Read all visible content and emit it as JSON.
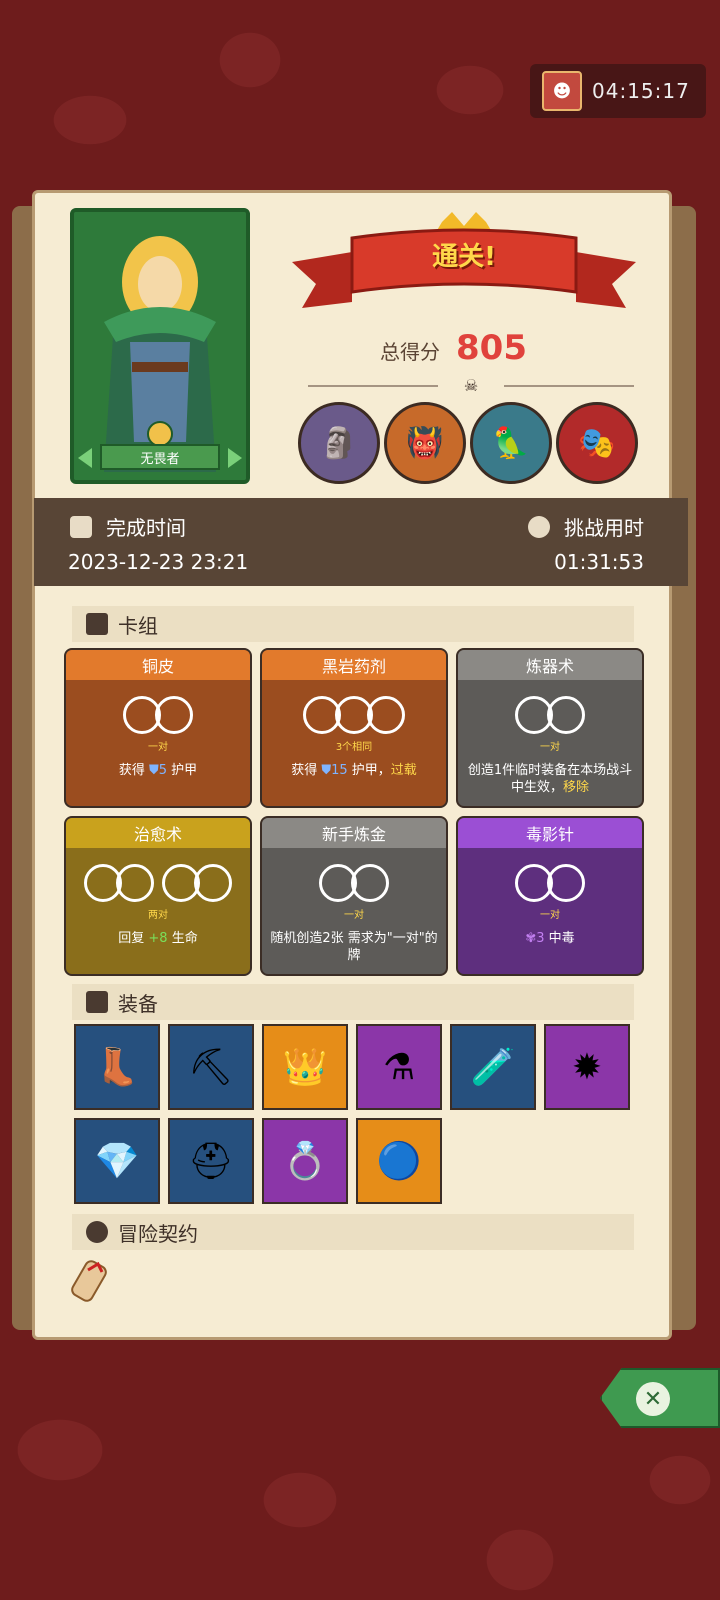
{
  "timer": {
    "time": "04:15:17",
    "avatar_icon": "boss-avatar-icon"
  },
  "hero": {
    "name": "无畏者"
  },
  "result": {
    "banner": "通关!",
    "score_label": "总得分",
    "score_value": "805"
  },
  "times": {
    "completion_label": "完成时间",
    "completion_value": "2023-12-23 23:21",
    "challenge_label": "挑战用时",
    "challenge_value": "01:31:53"
  },
  "deck": {
    "title": "卡组",
    "cards": [
      {
        "name": "铜皮",
        "count": "一对",
        "desc_pre": "获得 ",
        "desc_num": "5",
        "desc_post": " 护甲",
        "desc_hl": ""
      },
      {
        "name": "黑岩药剂",
        "count": "3个相同",
        "desc_pre": "获得 ",
        "desc_num": "15",
        "desc_post": " 护甲，",
        "desc_hl": "过载"
      },
      {
        "name": "炼器术",
        "count": "一对",
        "desc_pre": "创造1件临时装备在本场战斗中生效，",
        "desc_num": "",
        "desc_post": "",
        "desc_hl": "移除"
      },
      {
        "name": "治愈术",
        "count": "两对",
        "desc_pre": "回复 ",
        "desc_num": "+8",
        "desc_post": " 生命",
        "desc_hl": ""
      },
      {
        "name": "新手炼金",
        "count": "一对",
        "desc_pre": "随机创造2张 需求为\"一对\"的牌",
        "desc_num": "",
        "desc_post": "",
        "desc_hl": ""
      },
      {
        "name": "毒影针",
        "count": "一对",
        "desc_pre": "",
        "desc_num": "3",
        "desc_post": " 中毒",
        "desc_hl": ""
      }
    ]
  },
  "equipment": {
    "title": "装备",
    "items": [
      {
        "icon": "crystal-boot-icon",
        "glyph": "👢",
        "color": "blue"
      },
      {
        "icon": "scythe-icon",
        "glyph": "⛏",
        "color": "blue"
      },
      {
        "icon": "crown-icon",
        "glyph": "👑",
        "color": "orange"
      },
      {
        "icon": "purple-potion-icon",
        "glyph": "⚗",
        "color": "purple"
      },
      {
        "icon": "flask-icon",
        "glyph": "🧪",
        "color": "blue"
      },
      {
        "icon": "shadow-orb-icon",
        "glyph": "✹",
        "color": "purple"
      },
      {
        "icon": "diamond-icon",
        "glyph": "💎",
        "color": "blue"
      },
      {
        "icon": "golden-helmet-icon",
        "glyph": "⛑",
        "color": "blue"
      },
      {
        "icon": "emerald-ring-icon",
        "glyph": "💍",
        "color": "purple"
      },
      {
        "icon": "blue-amulet-icon",
        "glyph": "🔵",
        "color": "orange"
      }
    ]
  },
  "contract": {
    "title": "冒险契约"
  }
}
